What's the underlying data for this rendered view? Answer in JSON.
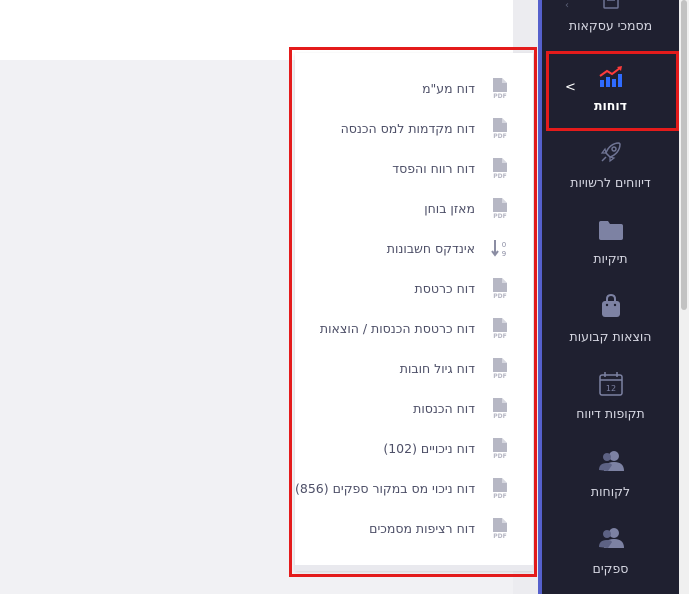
{
  "sidebar": {
    "items": [
      {
        "label": "מסמכי עסקאות",
        "icon": "document-icon"
      },
      {
        "label": "דוחות",
        "icon": "chart-growth-icon",
        "active": true
      },
      {
        "label": "דיווחים לרשויות",
        "icon": "rocket-icon"
      },
      {
        "label": "תיקיות",
        "icon": "folder-icon"
      },
      {
        "label": "הוצאות קבועות",
        "icon": "shopping-bag-icon"
      },
      {
        "label": "תקופות דיווח",
        "icon": "calendar-icon"
      },
      {
        "label": "לקוחות",
        "icon": "users-icon"
      },
      {
        "label": "ספקים",
        "icon": "users-icon"
      }
    ],
    "calendar_day": "12",
    "active_chevron": "<"
  },
  "reports_menu": {
    "items": [
      {
        "label": "דוח מע\"מ",
        "icon": "pdf-icon"
      },
      {
        "label": "דוח מקדמות למס הכנסה",
        "icon": "pdf-icon"
      },
      {
        "label": "דוח רווח והפסד",
        "icon": "pdf-icon"
      },
      {
        "label": "מאזן בוחן",
        "icon": "pdf-icon"
      },
      {
        "label": "אינדקס חשבונות",
        "icon": "sort-numeric-icon"
      },
      {
        "label": "דוח כרטסת",
        "icon": "pdf-icon"
      },
      {
        "label": "דוח כרטסת הכנסות / הוצאות",
        "icon": "pdf-icon"
      },
      {
        "label": "דוח גיול חובות",
        "icon": "pdf-icon"
      },
      {
        "label": "דוח הכנסות",
        "icon": "pdf-icon"
      },
      {
        "label": "דוח ניכויים (102)",
        "icon": "pdf-icon"
      },
      {
        "label": "דוח ניכוי מס במקור ספקים (856)",
        "icon": "pdf-icon"
      },
      {
        "label": "דוח רציפות מסמכים",
        "icon": "pdf-icon"
      }
    ]
  },
  "colors": {
    "sidebar_bg": "#1f2030",
    "accent_blue": "#2f6bff",
    "accent_red": "#ff3b3b",
    "highlight_border": "#e41b1b",
    "menu_text": "#4e5068",
    "pdf_icon": "#b6b7c4"
  }
}
